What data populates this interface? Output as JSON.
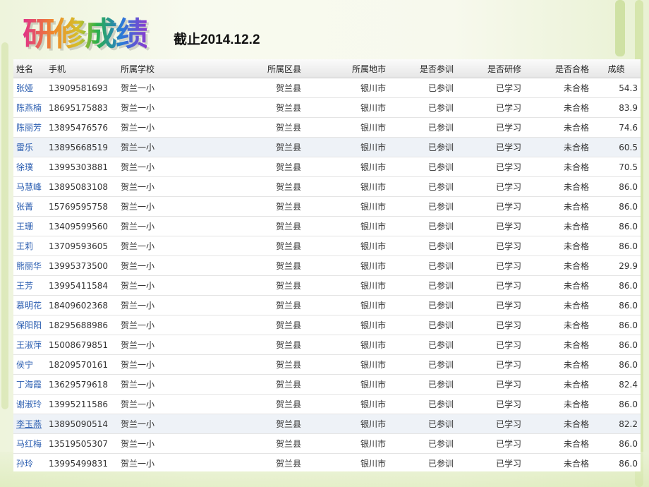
{
  "title": "研修成绩",
  "deadline": "截止2014.12.2",
  "table": {
    "headers": [
      "姓名",
      "手机",
      "所属学校",
      "所属区县",
      "所属地市",
      "是否参训",
      "是否研修",
      "是否合格",
      "成绩"
    ],
    "rows": [
      [
        "张娅",
        "13909581693",
        "贺兰一小",
        "贺兰县",
        "银川市",
        "已参训",
        "已学习",
        "未合格",
        "54.3"
      ],
      [
        "陈燕楠",
        "18695175883",
        "贺兰一小",
        "贺兰县",
        "银川市",
        "已参训",
        "已学习",
        "未合格",
        "83.9"
      ],
      [
        "陈丽芳",
        "13895476576",
        "贺兰一小",
        "贺兰县",
        "银川市",
        "已参训",
        "已学习",
        "未合格",
        "74.6"
      ],
      [
        "雷乐",
        "13895668519",
        "贺兰一小",
        "贺兰县",
        "银川市",
        "已参训",
        "已学习",
        "未合格",
        "60.5"
      ],
      [
        "徐璞",
        "13995303881",
        "贺兰一小",
        "贺兰县",
        "银川市",
        "已参训",
        "已学习",
        "未合格",
        "70.5"
      ],
      [
        "马慧峰",
        "13895083108",
        "贺兰一小",
        "贺兰县",
        "银川市",
        "已参训",
        "已学习",
        "未合格",
        "86.0"
      ],
      [
        "张菁",
        "15769595758",
        "贺兰一小",
        "贺兰县",
        "银川市",
        "已参训",
        "已学习",
        "未合格",
        "86.0"
      ],
      [
        "王珊",
        "13409599560",
        "贺兰一小",
        "贺兰县",
        "银川市",
        "已参训",
        "已学习",
        "未合格",
        "86.0"
      ],
      [
        "王莉",
        "13709593605",
        "贺兰一小",
        "贺兰县",
        "银川市",
        "已参训",
        "已学习",
        "未合格",
        "86.0"
      ],
      [
        "熊丽华",
        "13995373500",
        "贺兰一小",
        "贺兰县",
        "银川市",
        "已参训",
        "已学习",
        "未合格",
        "29.9"
      ],
      [
        "王芳",
        "13995411584",
        "贺兰一小",
        "贺兰县",
        "银川市",
        "已参训",
        "已学习",
        "未合格",
        "86.0"
      ],
      [
        "慕明花",
        "18409602368",
        "贺兰一小",
        "贺兰县",
        "银川市",
        "已参训",
        "已学习",
        "未合格",
        "86.0"
      ],
      [
        "保阳阳",
        "18295688986",
        "贺兰一小",
        "贺兰县",
        "银川市",
        "已参训",
        "已学习",
        "未合格",
        "86.0"
      ],
      [
        "王淑萍",
        "15008679851",
        "贺兰一小",
        "贺兰县",
        "银川市",
        "已参训",
        "已学习",
        "未合格",
        "86.0"
      ],
      [
        "侯宁",
        "18209570161",
        "贺兰一小",
        "贺兰县",
        "银川市",
        "已参训",
        "已学习",
        "未合格",
        "86.0"
      ],
      [
        "丁海霞",
        "13629579618",
        "贺兰一小",
        "贺兰县",
        "银川市",
        "已参训",
        "已学习",
        "未合格",
        "82.4"
      ],
      [
        "谢淑玲",
        "13995211586",
        "贺兰一小",
        "贺兰县",
        "银川市",
        "已参训",
        "已学习",
        "未合格",
        "86.0"
      ],
      [
        "李玉燕",
        "13895090514",
        "贺兰一小",
        "贺兰县",
        "银川市",
        "已参训",
        "已学习",
        "未合格",
        "82.2"
      ],
      [
        "马红梅",
        "13519505307",
        "贺兰一小",
        "贺兰县",
        "银川市",
        "已参训",
        "已学习",
        "未合格",
        "86.0"
      ],
      [
        "孙玲",
        "13995499831",
        "贺兰一小",
        "贺兰县",
        "银川市",
        "已参训",
        "已学习",
        "未合格",
        "86.0"
      ]
    ]
  }
}
